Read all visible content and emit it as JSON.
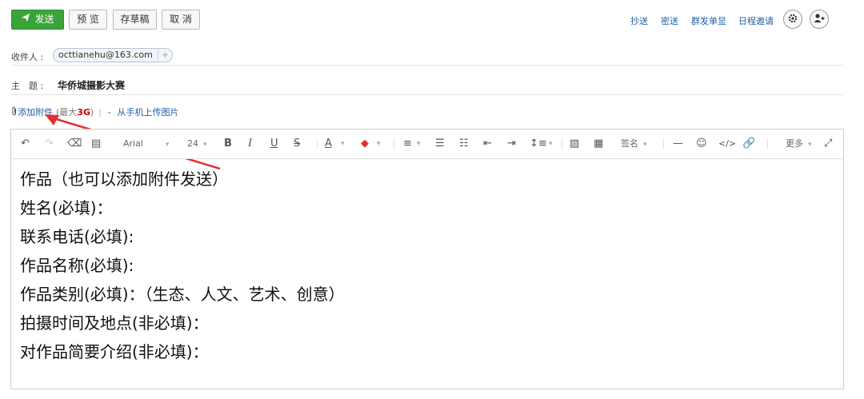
{
  "toolbar": {
    "send_label": "发送",
    "preview_label": "预 览",
    "draft_label": "存草稿",
    "cancel_label": "取 消"
  },
  "top_links": {
    "cc": "抄送",
    "bcc": "密送",
    "group_send": "群发单显",
    "schedule_invite": "日程邀请"
  },
  "recipient": {
    "label": "收件人 :",
    "email": "octtianehu@163.com",
    "add": "+"
  },
  "subject": {
    "label": "主　题 :",
    "value": "华侨城摄影大赛"
  },
  "attachment": {
    "add_label": "添加附件",
    "max_prefix": "(最大",
    "max_value": "3G",
    "max_suffix": ")",
    "separator": "|",
    "mobile_upload": "从手机上传图片"
  },
  "editor_toolbar": {
    "font_family": "Arial",
    "font_size": "24",
    "signature": "签名",
    "more": "更多"
  },
  "body_lines": [
    "作品（也可以添加附件发送）",
    "姓名(必填)：",
    "联系电话(必填):",
    "作品名称(必填):",
    "作品类别(必填)：（生态、人文、艺术、创意）",
    "拍摄时间及地点(非必填)：",
    "对作品简要介绍(非必填)："
  ],
  "colors": {
    "send_green": "#3aa33a",
    "link_blue": "#1f5fa8",
    "arrow_red": "#e03030"
  }
}
